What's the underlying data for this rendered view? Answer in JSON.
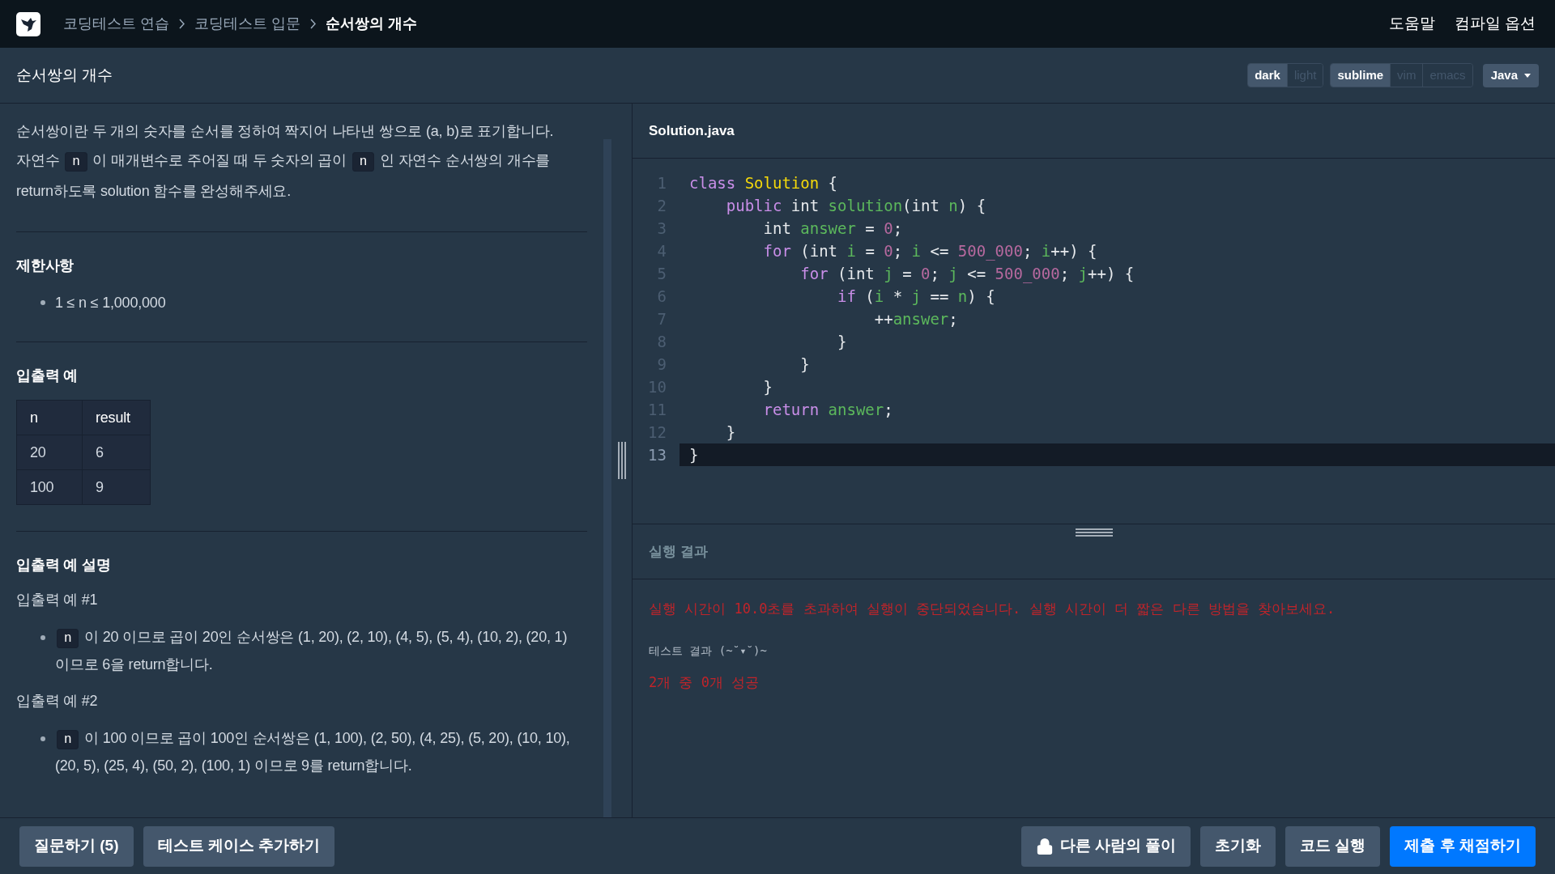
{
  "nav": {
    "breadcrumbs": [
      {
        "label": "코딩테스트 연습",
        "current": false
      },
      {
        "label": "코딩테스트 입문",
        "current": false
      },
      {
        "label": "순서쌍의 개수",
        "current": true
      }
    ],
    "links": [
      "도움말",
      "컴파일 옵션"
    ]
  },
  "title_bar": {
    "title": "순서쌍의 개수",
    "toggle_groups": [
      [
        {
          "label": "dark",
          "selected": true
        },
        {
          "label": "light",
          "selected": false
        }
      ],
      [
        {
          "label": "sublime",
          "selected": true
        },
        {
          "label": "vim",
          "selected": false
        },
        {
          "label": "emacs",
          "selected": false
        }
      ]
    ],
    "language": "Java"
  },
  "problem": {
    "description": [
      [
        {
          "kind": "text",
          "text": "순서쌍이란 두 개의 숫자를 순서를 정하여 짝지어 나타낸 쌍으로 (a, b)로 표기합니다. 자연수 "
        },
        {
          "kind": "code",
          "text": "n"
        },
        {
          "kind": "text",
          "text": " 이 매개변수로 주어질 때 두 숫자의 곱이 "
        },
        {
          "kind": "code",
          "text": "n"
        },
        {
          "kind": "text",
          "text": " 인 자연수 순서쌍의 개수를 return하도록 solution 함수를 완성해주세요."
        }
      ]
    ],
    "constraints_heading": "제한사항",
    "constraints": [
      "1 ≤ n ≤ 1,000,000"
    ],
    "examples_heading": "입출력 예",
    "table": {
      "columns": [
        "n",
        "result"
      ],
      "rows": [
        [
          "20",
          "6"
        ],
        [
          "100",
          "9"
        ]
      ]
    },
    "explanation_heading": "입출력 예 설명",
    "explanations": [
      {
        "title": "입출력 예 #1",
        "items": [
          [
            {
              "kind": "code",
              "text": "n"
            },
            {
              "kind": "text",
              "text": " 이 20 이므로 곱이 20인 순서쌍은 (1, 20), (2, 10), (4, 5), (5, 4), (10, 2), (20, 1) 이므로 6을 return합니다."
            }
          ]
        ]
      },
      {
        "title": "입출력 예 #2",
        "items": [
          [
            {
              "kind": "code",
              "text": "n"
            },
            {
              "kind": "text",
              "text": " 이 100 이므로 곱이 100인 순서쌍은 (1, 100), (2, 50), (4, 25), (5, 20), (10, 10), (20, 5), (25, 4), (50, 2), (100, 1) 이므로 9를 return합니다."
            }
          ]
        ]
      }
    ]
  },
  "editor": {
    "filename": "Solution.java",
    "lines": [
      {
        "number": "1",
        "current": false,
        "tokens": [
          {
            "kind": "kw",
            "text": "class"
          },
          {
            "kind": "cls",
            "text": " Solution"
          },
          {
            "kind": "plain",
            "text": " {"
          }
        ]
      },
      {
        "number": "2",
        "current": false,
        "tokens": [
          {
            "kind": "kw",
            "text": "    public"
          },
          {
            "kind": "plain",
            "text": " int "
          },
          {
            "kind": "fn",
            "text": "solution"
          },
          {
            "kind": "plain",
            "text": "(int "
          },
          {
            "kind": "var",
            "text": "n"
          },
          {
            "kind": "plain",
            "text": ") {"
          }
        ]
      },
      {
        "number": "3",
        "current": false,
        "tokens": [
          {
            "kind": "plain",
            "text": "        int "
          },
          {
            "kind": "var",
            "text": "answer"
          },
          {
            "kind": "plain",
            "text": " = "
          },
          {
            "kind": "num",
            "text": "0"
          },
          {
            "kind": "plain",
            "text": ";"
          }
        ]
      },
      {
        "number": "4",
        "current": false,
        "tokens": [
          {
            "kind": "kw",
            "text": "        for"
          },
          {
            "kind": "plain",
            "text": " (int "
          },
          {
            "kind": "var",
            "text": "i"
          },
          {
            "kind": "plain",
            "text": " = "
          },
          {
            "kind": "num",
            "text": "0"
          },
          {
            "kind": "plain",
            "text": "; "
          },
          {
            "kind": "var",
            "text": "i"
          },
          {
            "kind": "plain",
            "text": " <= "
          },
          {
            "kind": "num",
            "text": "500_000"
          },
          {
            "kind": "plain",
            "text": "; "
          },
          {
            "kind": "var",
            "text": "i"
          },
          {
            "kind": "plain",
            "text": "++) {"
          }
        ]
      },
      {
        "number": "5",
        "current": false,
        "tokens": [
          {
            "kind": "kw",
            "text": "            for"
          },
          {
            "kind": "plain",
            "text": " (int "
          },
          {
            "kind": "var",
            "text": "j"
          },
          {
            "kind": "plain",
            "text": " = "
          },
          {
            "kind": "num",
            "text": "0"
          },
          {
            "kind": "plain",
            "text": "; "
          },
          {
            "kind": "var",
            "text": "j"
          },
          {
            "kind": "plain",
            "text": " <= "
          },
          {
            "kind": "num",
            "text": "500_000"
          },
          {
            "kind": "plain",
            "text": "; "
          },
          {
            "kind": "var",
            "text": "j"
          },
          {
            "kind": "plain",
            "text": "++) {"
          }
        ]
      },
      {
        "number": "6",
        "current": false,
        "tokens": [
          {
            "kind": "kw",
            "text": "                if"
          },
          {
            "kind": "plain",
            "text": " ("
          },
          {
            "kind": "var",
            "text": "i"
          },
          {
            "kind": "plain",
            "text": " * "
          },
          {
            "kind": "var",
            "text": "j"
          },
          {
            "kind": "plain",
            "text": " == "
          },
          {
            "kind": "var",
            "text": "n"
          },
          {
            "kind": "plain",
            "text": ") {"
          }
        ]
      },
      {
        "number": "7",
        "current": false,
        "tokens": [
          {
            "kind": "plain",
            "text": "                    ++"
          },
          {
            "kind": "var",
            "text": "answer"
          },
          {
            "kind": "plain",
            "text": ";"
          }
        ]
      },
      {
        "number": "8",
        "current": false,
        "tokens": [
          {
            "kind": "plain",
            "text": "                }"
          }
        ]
      },
      {
        "number": "9",
        "current": false,
        "tokens": [
          {
            "kind": "plain",
            "text": "            }"
          }
        ]
      },
      {
        "number": "10",
        "current": false,
        "tokens": [
          {
            "kind": "plain",
            "text": "        }"
          }
        ]
      },
      {
        "number": "11",
        "current": false,
        "tokens": [
          {
            "kind": "kw",
            "text": "        return"
          },
          {
            "kind": "var",
            "text": " answer"
          },
          {
            "kind": "plain",
            "text": ";"
          }
        ]
      },
      {
        "number": "12",
        "current": false,
        "tokens": [
          {
            "kind": "plain",
            "text": "    }"
          }
        ]
      },
      {
        "number": "13",
        "current": true,
        "tokens": [
          {
            "kind": "plain",
            "text": "}"
          }
        ]
      }
    ]
  },
  "result": {
    "heading": "실행 결과",
    "error": "실행 시간이 10.0초를 초과하여 실행이 중단되었습니다. 실행 시간이 더 짧은 다른 방법을 찾아보세요.",
    "test_label": "테스트 결과 (~˘▾˘)~",
    "summary": "2개 중 0개 성공"
  },
  "footer": {
    "left_buttons": [
      "질문하기 (5)",
      "테스트 케이스 추가하기"
    ],
    "right_buttons": [
      {
        "label": "다른 사람의 풀이",
        "kind": "locked"
      },
      {
        "label": "초기화",
        "kind": "normal"
      },
      {
        "label": "코드 실행",
        "kind": "normal"
      },
      {
        "label": "제출 후 채점하기",
        "kind": "primary"
      }
    ]
  }
}
